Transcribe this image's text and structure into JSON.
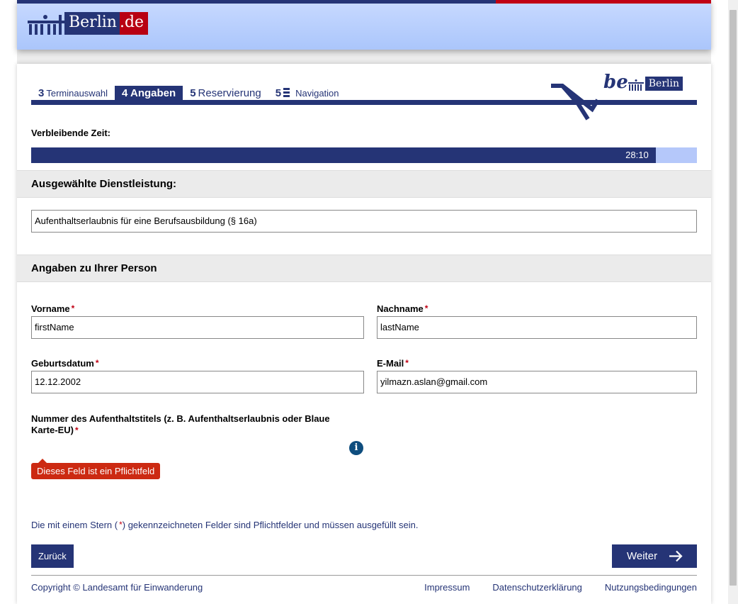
{
  "header": {
    "logo_text": "Berlin",
    "logo_suffix": ".de"
  },
  "steps": [
    {
      "num": "3",
      "label": "Terminauswahl"
    },
    {
      "num": "4",
      "label": "Angaben"
    },
    {
      "num": "5",
      "label": "Reservierung"
    },
    {
      "num": "5",
      "label": "Navigation"
    }
  ],
  "be_logo": {
    "be": "be",
    "berlin": "Berlin"
  },
  "timer": {
    "label": "Verbleibende Zeit:",
    "value": "28:10",
    "remaining_fraction": 0.938
  },
  "service": {
    "heading": "Ausgewählte Dienstleistung:",
    "value": "Aufenthaltserlaubnis für eine Berufsausbildung (§ 16a)"
  },
  "person": {
    "heading": "Angaben zu Ihrer Person",
    "vorname_label": "Vorname",
    "vorname": "firstName",
    "nachname_label": "Nachname",
    "nachname": "lastName",
    "geburtsdatum_label": "Geburtsdatum",
    "geburtsdatum": "12.12.2002",
    "email_label": "E-Mail",
    "email": "yilmazn.aslan@gmail.com",
    "titel_label": "Nummer des Aufenthaltstitels (z. B. Aufenthaltserlaubnis oder Blaue Karte-EU)",
    "error": "Dieses Feld ist ein Pflichtfeld",
    "required_star": "*"
  },
  "note": {
    "before": "Die mit einem Stern (",
    "star": "*",
    "after": ") gekennzeichneten Felder sind Pflichtfelder und müssen ausgefüllt sein."
  },
  "buttons": {
    "back": "Zurück",
    "next": "Weiter"
  },
  "footer": {
    "copyright": "Copyright © Landesamt für Einwanderung",
    "links": [
      "Impressum",
      "Datenschutzerklärung",
      "Nutzungsbedingungen"
    ]
  }
}
